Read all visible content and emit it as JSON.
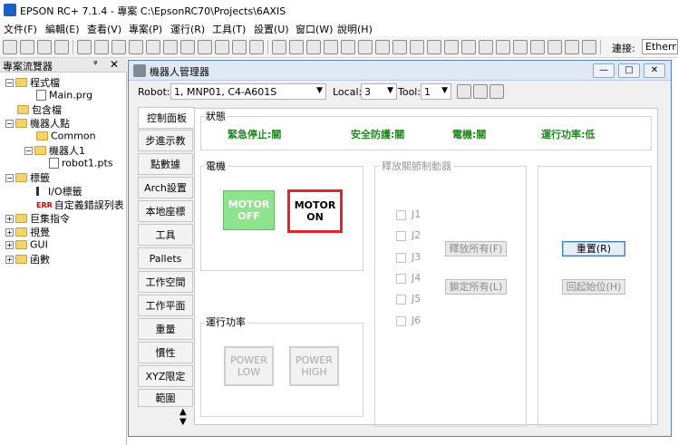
{
  "app": {
    "title": "EPSON RC+ 7.1.4 - 專案 C:\\EpsonRC70\\Projects\\6AXIS"
  },
  "menu": [
    "文件(F)",
    "編輯(E)",
    "查看(V)",
    "專案(P)",
    "運行(R)",
    "工具(T)",
    "設置(U)",
    "窗口(W)",
    "說明(H)"
  ],
  "toolbar": {
    "connect_label": "連接:",
    "connect_value": "Etherr"
  },
  "explorer": {
    "title": "專案流覽器",
    "pin": "ᵠ",
    "close": "✕",
    "tree": [
      {
        "label": "程式檔",
        "exp": "−",
        "kind": "folder"
      },
      {
        "label": "Main.prg",
        "kind": "file"
      },
      {
        "label": "包含檔",
        "kind": "folder"
      },
      {
        "label": "機器人點",
        "exp": "−",
        "kind": "folder"
      },
      {
        "label": "Common",
        "kind": "folder"
      },
      {
        "label": "機器人1",
        "exp": "−",
        "kind": "folder"
      },
      {
        "label": "robot1.pts",
        "kind": "file"
      },
      {
        "label": "標籤",
        "exp": "−",
        "kind": "folder"
      },
      {
        "label": "I/O標籤",
        "kind": "io"
      },
      {
        "label": "自定義錯誤列表",
        "kind": "err",
        "prefix": "ERR"
      },
      {
        "label": "巨集指令",
        "exp": "+",
        "kind": "folder"
      },
      {
        "label": "視覺",
        "exp": "+",
        "kind": "folder"
      },
      {
        "label": "GUI",
        "exp": "+",
        "kind": "folder"
      },
      {
        "label": "函數",
        "exp": "+",
        "kind": "folder"
      }
    ]
  },
  "robot_manager": {
    "title": "機器人管理器",
    "robot_label": "Robot:",
    "robot_value": "1, MNP01, C4-A601S",
    "local_label": "Local:",
    "local_value": "3",
    "tool_label": "Tool:",
    "tool_value": "1",
    "tabs": [
      "控制面板",
      "步進示教",
      "點數據",
      "Arch設置",
      "本地座標",
      "工具",
      "Pallets",
      "工作空間",
      "工作平面",
      "重量",
      "慣性",
      "XYZ限定",
      "範圍"
    ],
    "status": {
      "title": "狀態",
      "estop": "緊急停止:關",
      "safeguard": "安全防護:關",
      "motor": "電機:關",
      "power": "運行功率:低"
    },
    "motor_group": {
      "title": "電機",
      "off_line1": "MOTOR",
      "off_line2": "OFF",
      "on_line1": "MOTOR",
      "on_line2": "ON"
    },
    "power_group": {
      "title": "運行功率",
      "low_line1": "POWER",
      "low_line2": "LOW",
      "high_line1": "POWER",
      "high_line2": "HIGH"
    },
    "brake_group": {
      "title": "釋放關節制動器",
      "joints": [
        "J1",
        "J2",
        "J3",
        "J4",
        "J5",
        "J6"
      ],
      "release_all": "釋放所有(F)",
      "lock_all": "鎖定所有(L)"
    },
    "reset_label": "重置(R)",
    "home_label": "回起始位(H)"
  }
}
